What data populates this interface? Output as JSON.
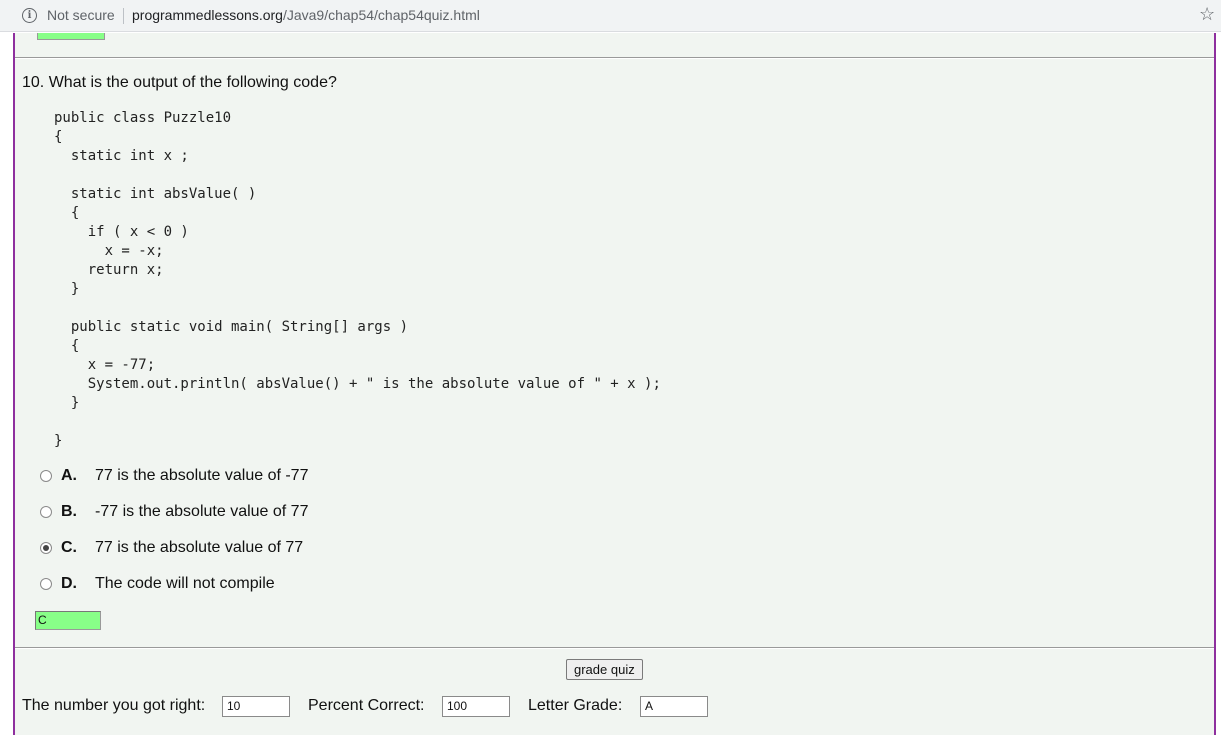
{
  "browser": {
    "security_label": "Not secure",
    "url_host": "programmedlessons.org",
    "url_path": "/Java9/chap54/chap54quiz.html",
    "info_icon": "info-icon",
    "bookmark_icon": "star-icon"
  },
  "question": {
    "text": "10. What is the output of the following code?",
    "code": "public class Puzzle10\n{\n  static int x ;\n\n  static int absValue( )\n  {\n    if ( x < 0 )\n      x = -x;\n    return x;\n  }\n\n  public static void main( String[] args )\n  {\n    x = -77;\n    System.out.println( absValue() + \" is the absolute value of \" + x );\n  }\n\n}",
    "options": [
      {
        "letter": "A.",
        "text": "77 is the absolute value of -77",
        "selected": false
      },
      {
        "letter": "B.",
        "text": "-77 is the absolute value of 77",
        "selected": false
      },
      {
        "letter": "C.",
        "text": "77 is the absolute value of 77",
        "selected": true
      },
      {
        "letter": "D.",
        "text": "The code will not compile",
        "selected": false
      }
    ],
    "answer_value": "C"
  },
  "grading": {
    "button_label": "grade quiz",
    "right_label": "The number you got right:",
    "right_value": "10",
    "percent_label": "Percent Correct:",
    "percent_value": "100",
    "grade_label": "Letter Grade:",
    "grade_value": "A"
  },
  "colors": {
    "answer_correct_bg": "#88ff88",
    "page_bg": "#f1f5f1",
    "page_border": "#8e2f9e"
  }
}
